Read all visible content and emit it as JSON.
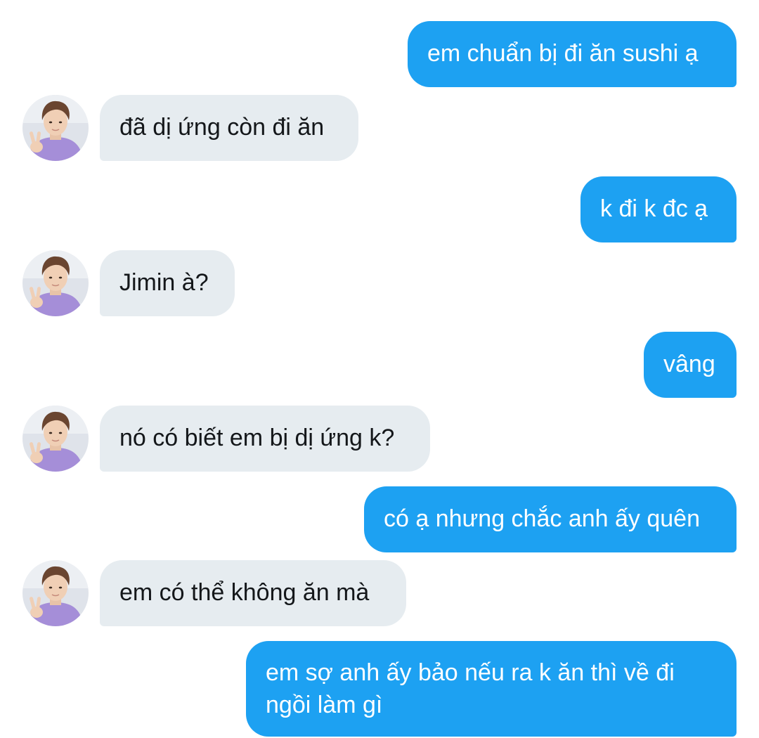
{
  "conversation": {
    "messages": [
      {
        "sender": "me",
        "text": "em chuẩn bị đi ăn sushi ạ"
      },
      {
        "sender": "contact",
        "text": "đã dị ứng còn đi ăn"
      },
      {
        "sender": "me",
        "text": "k đi k đc ạ"
      },
      {
        "sender": "contact",
        "text": "Jimin à?"
      },
      {
        "sender": "me",
        "text": "vâng"
      },
      {
        "sender": "contact",
        "text": "nó có biết em bị dị ứng k?"
      },
      {
        "sender": "me",
        "text": "có ạ nhưng chắc anh ấy quên"
      },
      {
        "sender": "contact",
        "text": "em có thể không ăn mà"
      },
      {
        "sender": "me",
        "text_line1": "em sợ anh ấy bảo nếu ra k ăn thì về đi",
        "text_line2": "ngồi làm gì"
      }
    ]
  },
  "colors": {
    "sent_bubble": "#1da1f2",
    "received_bubble": "#e6ecf0",
    "sent_text": "#ffffff",
    "received_text": "#14171a"
  },
  "icons": {
    "contact_avatar": "profile-photo-avatar"
  }
}
